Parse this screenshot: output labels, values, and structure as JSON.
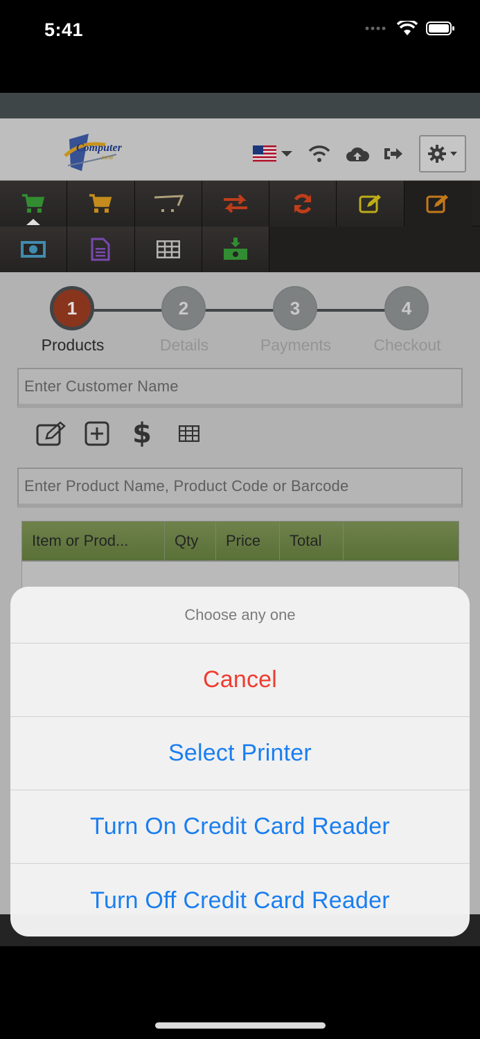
{
  "status_bar": {
    "time": "5:41"
  },
  "app": {
    "logo": {
      "name": "Computer",
      "sub": "zone"
    },
    "colors": {
      "topbar": "#475052",
      "toolbar": "#282624",
      "step_active": "#9c3d22",
      "table_header": "#738a4c"
    }
  },
  "toolbar": {
    "row1": [
      {
        "icon": "cart-icon",
        "color": "#3aa13a",
        "active": true
      },
      {
        "icon": "cart-icon",
        "color": "#e0a020"
      },
      {
        "icon": "empty-cart-icon",
        "color": "#c7b58d"
      },
      {
        "icon": "transfer-icon",
        "color": "#d9461f"
      },
      {
        "icon": "refresh-icon",
        "color": "#d9461f"
      },
      {
        "icon": "edit-icon",
        "color": "#d9c51b"
      },
      {
        "icon": "edit-icon",
        "color": "#e08a1e"
      }
    ],
    "row2": [
      {
        "icon": "cash-icon",
        "color": "#4a9fc7"
      },
      {
        "icon": "document-icon",
        "color": "#8a55c9"
      },
      {
        "icon": "table-icon",
        "color": "#cfcfcf"
      },
      {
        "icon": "download-icon",
        "color": "#3aa13a"
      }
    ]
  },
  "stepper": {
    "steps": [
      {
        "number": "1",
        "label": "Products"
      },
      {
        "number": "2",
        "label": "Details"
      },
      {
        "number": "3",
        "label": "Payments"
      },
      {
        "number": "4",
        "label": "Checkout"
      }
    ]
  },
  "customer": {
    "placeholder": "Enter Customer Name"
  },
  "product_search": {
    "placeholder": "Enter Product Name, Product Code or Barcode"
  },
  "table": {
    "columns": [
      "Item or Prod...",
      "Qty",
      "Price",
      "Total",
      ""
    ]
  },
  "action_sheet": {
    "title": "Choose any one",
    "buttons": [
      "Cancel",
      "Select Printer",
      "Turn On Credit Card Reader",
      "Turn Off Credit Card Reader"
    ]
  }
}
